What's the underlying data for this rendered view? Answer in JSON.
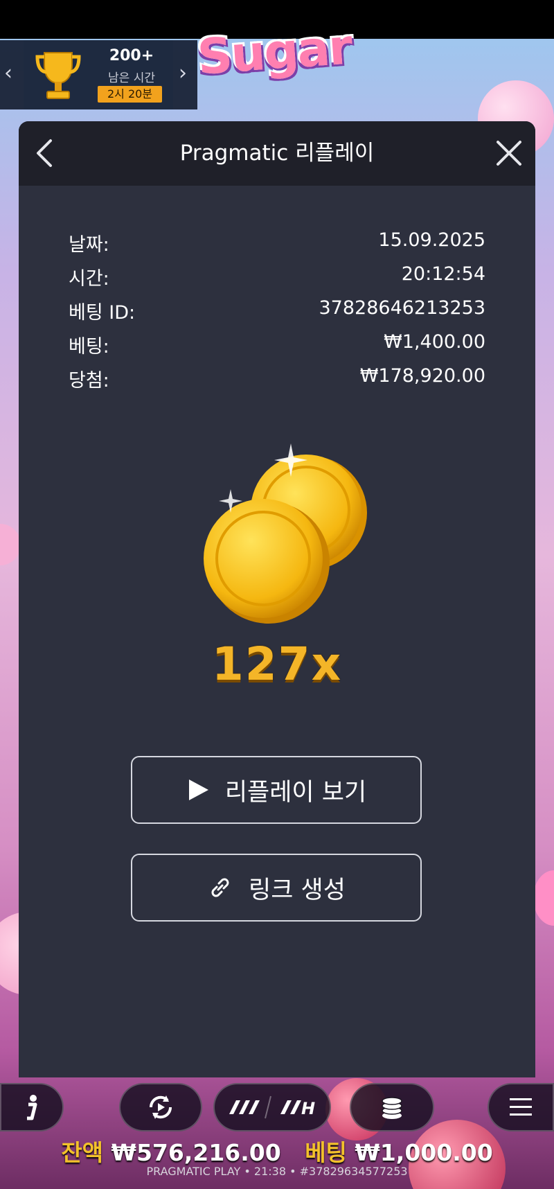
{
  "tournament": {
    "count": "200+",
    "remaining_label": "남은 시간",
    "timer": "2시 20분"
  },
  "game_logo": "Sugar",
  "modal": {
    "title": "Pragmatic 리플레이",
    "details": [
      {
        "label": "날짜:",
        "value": "15.09.2025"
      },
      {
        "label": "시간:",
        "value": "20:12:54"
      },
      {
        "label": "베팅 ID:",
        "value": "37828646213253"
      },
      {
        "label": "베팅:",
        "value": "₩1,400.00"
      },
      {
        "label": "당첨:",
        "value": "₩178,920.00"
      }
    ],
    "multiplier": "127x",
    "replay_button": "리플레이 보기",
    "link_button": "링크 생성"
  },
  "bottom": {
    "balance_label": "잔액",
    "balance_value": "₩576,216.00",
    "bet_label": "베팅",
    "bet_value": "₩1,000.00",
    "footer": "PRAGMATIC PLAY • 21:38 • #37829634577253"
  },
  "colors": {
    "modal_bg": "#2d303e",
    "header_bg": "#1f2029",
    "accent_gold": "#f4b528",
    "timer_badge": "#f2a21d"
  }
}
